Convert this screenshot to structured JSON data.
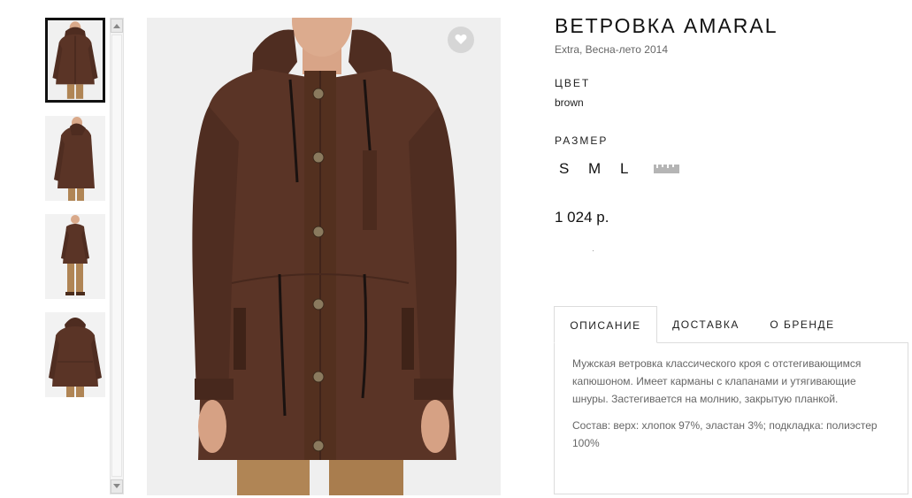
{
  "product": {
    "title": "ВЕТРОВКА AMARAL",
    "subtitle": "Extra, Весна-лето 2014",
    "color_label": "ЦВЕТ",
    "color_value": "brown",
    "size_label": "РАЗМЕР",
    "sizes": [
      "S",
      "M",
      "L"
    ],
    "price": "1 024 р.",
    "jacket_color": "#5a3426",
    "pants_color": "#b08555"
  },
  "thumbnails": [
    {
      "name": "front-view",
      "active": true
    },
    {
      "name": "side-view",
      "active": false
    },
    {
      "name": "full-length-view",
      "active": false
    },
    {
      "name": "back-view",
      "active": false
    }
  ],
  "icons": {
    "favorite": "heart-icon",
    "size_chart": "ruler-icon",
    "scroll_up": "chevron-up-icon",
    "scroll_down": "chevron-down-icon"
  },
  "tabs": [
    {
      "label": "ОПИСАНИЕ",
      "active": true
    },
    {
      "label": "ДОСТАВКА",
      "active": false
    },
    {
      "label": "О БРЕНДЕ",
      "active": false
    }
  ],
  "description": {
    "text": "Мужская ветровка классического кроя с отстегивающимся капюшоном. Имеет карманы с клапанами и утягивающие шнуры. Застегивается на молнию, закрытую планкой.",
    "composition": "Состав: верх: хлопок 97%, эластан 3%; подкладка: полиэстер 100%"
  }
}
